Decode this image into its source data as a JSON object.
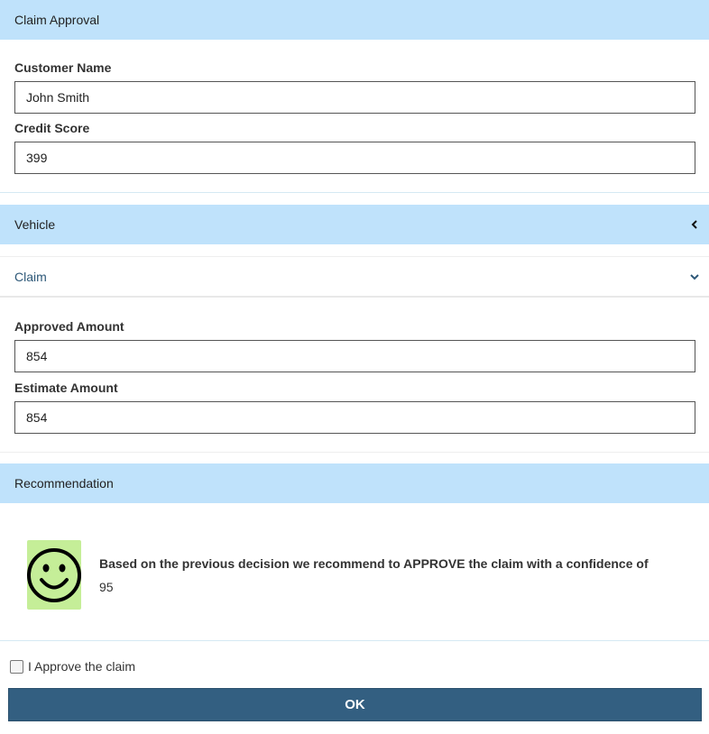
{
  "claim_approval": {
    "header": "Claim Approval",
    "customer_name_label": "Customer Name",
    "customer_name_value": "John Smith",
    "credit_score_label": "Credit Score",
    "credit_score_value": "399"
  },
  "vehicle": {
    "header": "Vehicle",
    "chevron": "chevron-left-icon"
  },
  "claim": {
    "header": "Claim",
    "chevron": "chevron-down-icon",
    "approved_amount_label": "Approved Amount",
    "approved_amount_value": "854",
    "estimate_amount_label": "Estimate Amount",
    "estimate_amount_value": "854"
  },
  "recommendation": {
    "header": "Recommendation",
    "icon": "smiley-icon",
    "icon_bg_color": "#c5ee98",
    "text": "Based on the previous decision we recommend to APPROVE the claim with a confidence of",
    "confidence": "95"
  },
  "approve": {
    "checkbox_label": "I Approve the claim",
    "checked": false
  },
  "ok_button": "OK",
  "colors": {
    "header_bg": "#bfe2fb",
    "button_bg": "#335f81"
  }
}
